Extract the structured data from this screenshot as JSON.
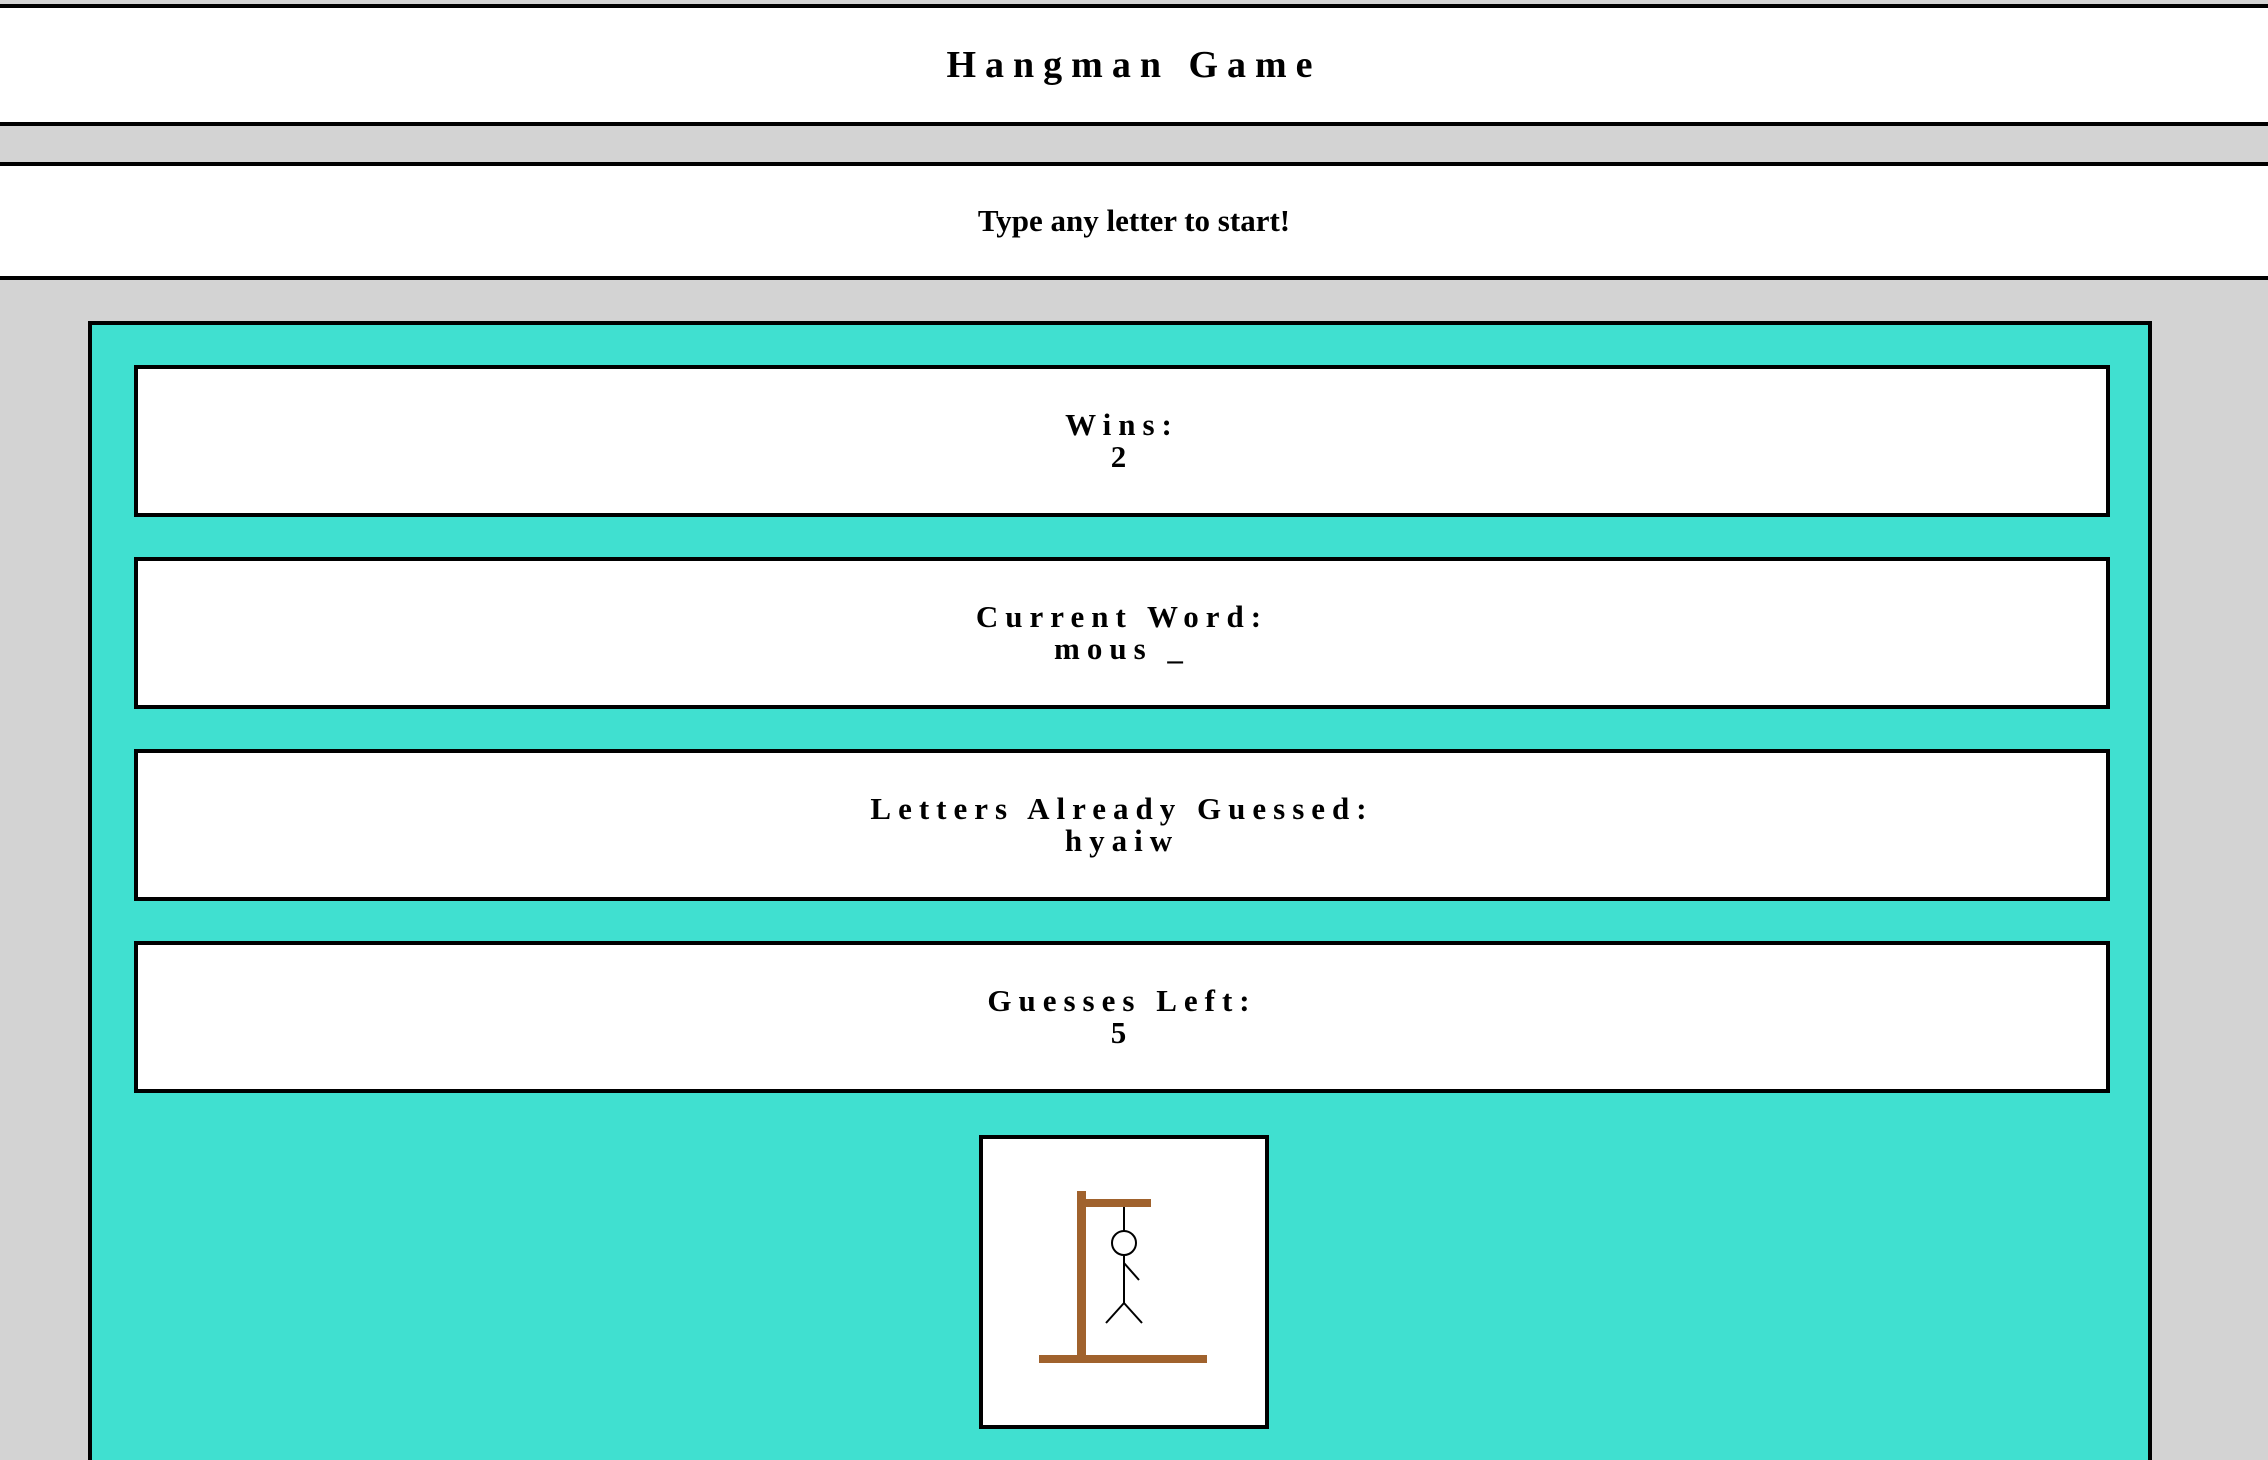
{
  "game": {
    "title": "Hangman Game",
    "message": "Type any letter to start!"
  },
  "stats": {
    "wins_label": "Wins:",
    "wins_value": "2",
    "current_word_label": "Current Word:",
    "current_word_value": "mous _",
    "letters_guessed_label": "Letters Already Guessed:",
    "letters_guessed_value": "hyaiw",
    "guesses_left_label": "Guesses Left:",
    "guesses_left_value": "5"
  },
  "hangman_image": {
    "icon": "gallows-stick-figure",
    "gallows_color": "#a0622d",
    "figure_color": "#000000"
  },
  "colors": {
    "page_background": "#d3d3d3",
    "panel_background": "#40e0d0",
    "box_background": "#ffffff",
    "border": "#000000"
  }
}
